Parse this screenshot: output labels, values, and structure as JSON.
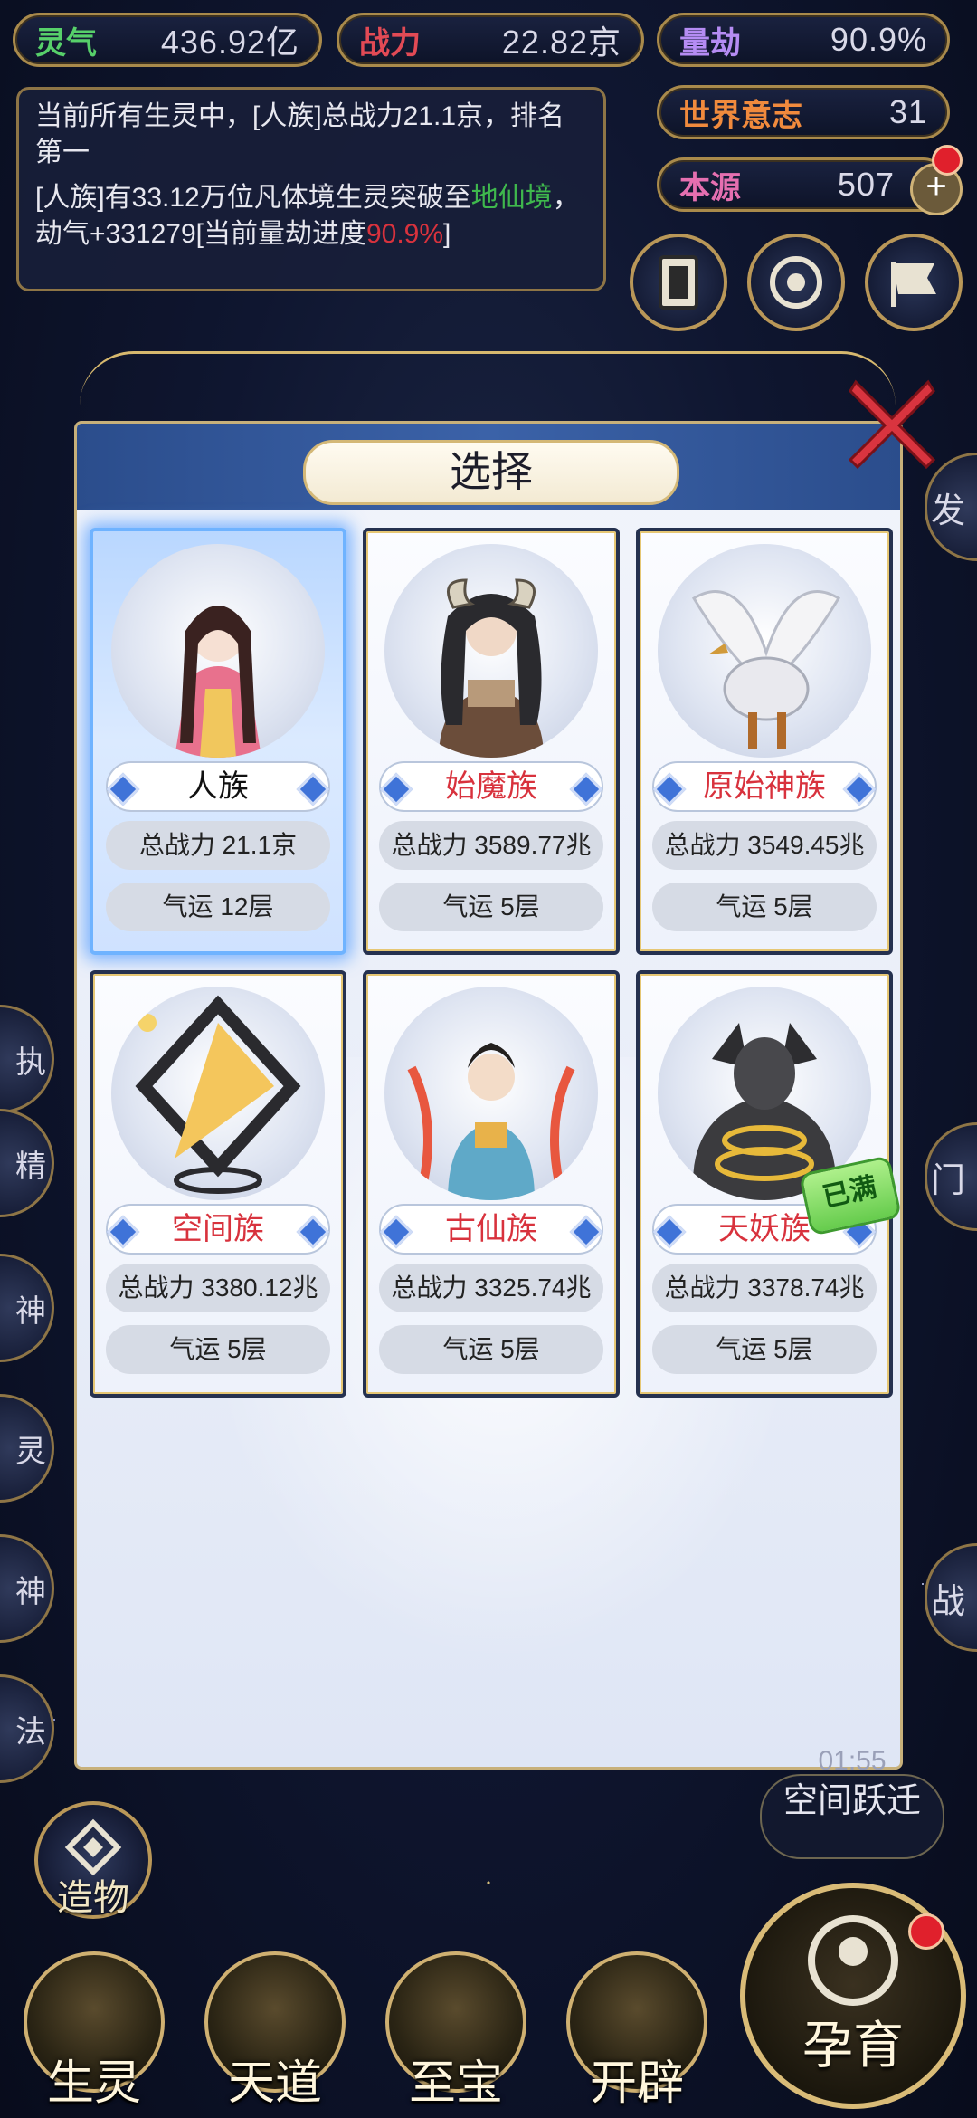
{
  "stats": {
    "lingqi": {
      "key": "灵气",
      "value": "436.92亿"
    },
    "zhanli": {
      "key": "战力",
      "value": "22.82京"
    },
    "liangjie": {
      "key": "量劫",
      "value": "90.9%"
    },
    "world_will": {
      "key": "世界意志",
      "value": "31"
    },
    "benyuan": {
      "key": "本源",
      "value": "507"
    }
  },
  "message": {
    "line1": "当前所有生灵中，[人族]总战力21.1京，排名第一",
    "line2_a": "[人族]有33.12万位凡体境生灵突破至",
    "line2_green": "地仙境",
    "line2_b": "，劫气+331279[当前量劫进度",
    "line2_red": "90.9%",
    "line2_end": "]"
  },
  "modal": {
    "title": "选择"
  },
  "races": [
    {
      "name": "人族",
      "power_label": "总战力",
      "power": "21.1京",
      "luck_label": "气运",
      "luck": "12层",
      "selected": true,
      "full": false
    },
    {
      "name": "始魔族",
      "power_label": "总战力",
      "power": "3589.77兆",
      "luck_label": "气运",
      "luck": "5层",
      "selected": false,
      "full": false
    },
    {
      "name": "原始神族",
      "power_label": "总战力",
      "power": "3549.45兆",
      "luck_label": "气运",
      "luck": "5层",
      "selected": false,
      "full": false
    },
    {
      "name": "空间族",
      "power_label": "总战力",
      "power": "3380.12兆",
      "luck_label": "气运",
      "luck": "5层",
      "selected": false,
      "full": false
    },
    {
      "name": "古仙族",
      "power_label": "总战力",
      "power": "3325.74兆",
      "luck_label": "气运",
      "luck": "5层",
      "selected": false,
      "full": false
    },
    {
      "name": "天妖族",
      "power_label": "总战力",
      "power": "3378.74兆",
      "luck_label": "气运",
      "luck": "5层",
      "selected": false,
      "full": true,
      "full_label": "已满"
    }
  ],
  "side_left_labels": [
    "执",
    "精",
    "神",
    "灵",
    "神",
    "法"
  ],
  "side_right_labels": [
    "发",
    "门",
    "战"
  ],
  "space_leap": {
    "time": "01:55",
    "label": "空间跃迁"
  },
  "create": {
    "label": "造物"
  },
  "bottom_nav": [
    "生灵",
    "天道",
    "至宝",
    "开辟"
  ],
  "breed": {
    "label": "孕育"
  }
}
